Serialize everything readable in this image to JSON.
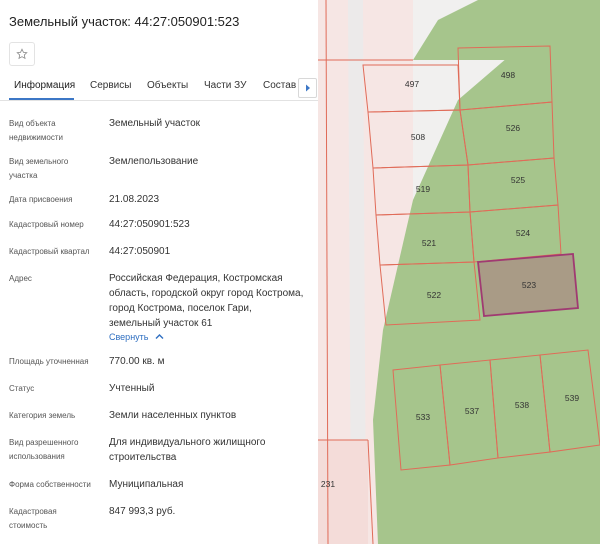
{
  "panel": {
    "title": "Земельный участок: 44:27:050901:523",
    "tabs": [
      "Информация",
      "Сервисы",
      "Объекты",
      "Части ЗУ",
      "Состав"
    ],
    "collapse_link": "Свернуть",
    "fields": [
      {
        "label": "Вид объекта недвижимости",
        "value": "Земельный участок"
      },
      {
        "label": "Вид земельного участка",
        "value": "Землепользование"
      },
      {
        "label": "Дата присвоения",
        "value": "21.08.2023"
      },
      {
        "label": "Кадастровый номер",
        "value": "44:27:050901:523"
      },
      {
        "label": "Кадастровый квартал",
        "value": "44:27:050901"
      },
      {
        "label": "Адрес",
        "value": "Российская Федерация, Костромская область, городской округ город Кострома, город Кострома, поселок Гари, земельный участок 61"
      },
      {
        "label": "Площадь уточненная",
        "value": "770.00 кв. м"
      },
      {
        "label": "Статус",
        "value": "Учтенный"
      },
      {
        "label": "Категория земель",
        "value": "Земли населенных пунктов"
      },
      {
        "label": "Вид разрешенного использования",
        "value": "Для индивидуального жилищного строительства"
      },
      {
        "label": "Форма собственности",
        "value": "Муниципальная"
      },
      {
        "label": "Кадастровая стоимость",
        "value": "847 993,3 руб."
      }
    ]
  },
  "map": {
    "plots": [
      "497",
      "498",
      "508",
      "526",
      "519",
      "525",
      "521",
      "524",
      "522",
      "523",
      "533",
      "537",
      "538",
      "539",
      "231"
    ],
    "selected_plot": "523",
    "colors": {
      "green": "#a6c58c",
      "pink": "#f7e3e1",
      "boundary": "#e06b58",
      "selected_fill": "#a99b86",
      "selected_border": "#a03a72"
    }
  }
}
